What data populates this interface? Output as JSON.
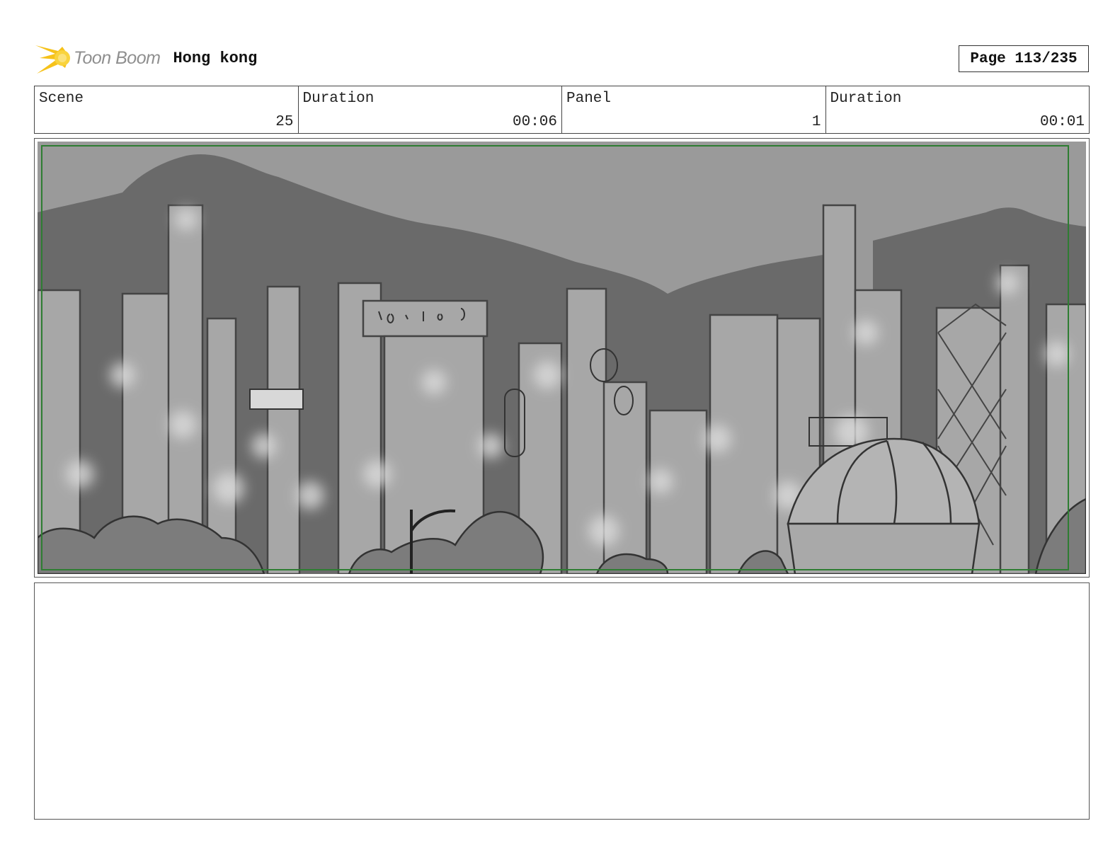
{
  "header": {
    "logo_text": "Toon Boom",
    "project_title": "Hong kong",
    "page_label": "Page 113/235"
  },
  "info": {
    "scene_label": "Scene",
    "scene_value": "25",
    "scene_duration_label": "Duration",
    "scene_duration_value": "00:06",
    "panel_label": "Panel",
    "panel_value": "1",
    "panel_duration_label": "Duration",
    "panel_duration_value": "00:01"
  },
  "panel": {
    "subject": "Hong Kong skyline at night with mountains behind, grayscale storyboard sketch",
    "border_color": "#2e7d32"
  },
  "notes": {
    "text": ""
  },
  "colors": {
    "logo_star": "#f6c21a",
    "logo_text": "#8f8f8f"
  }
}
